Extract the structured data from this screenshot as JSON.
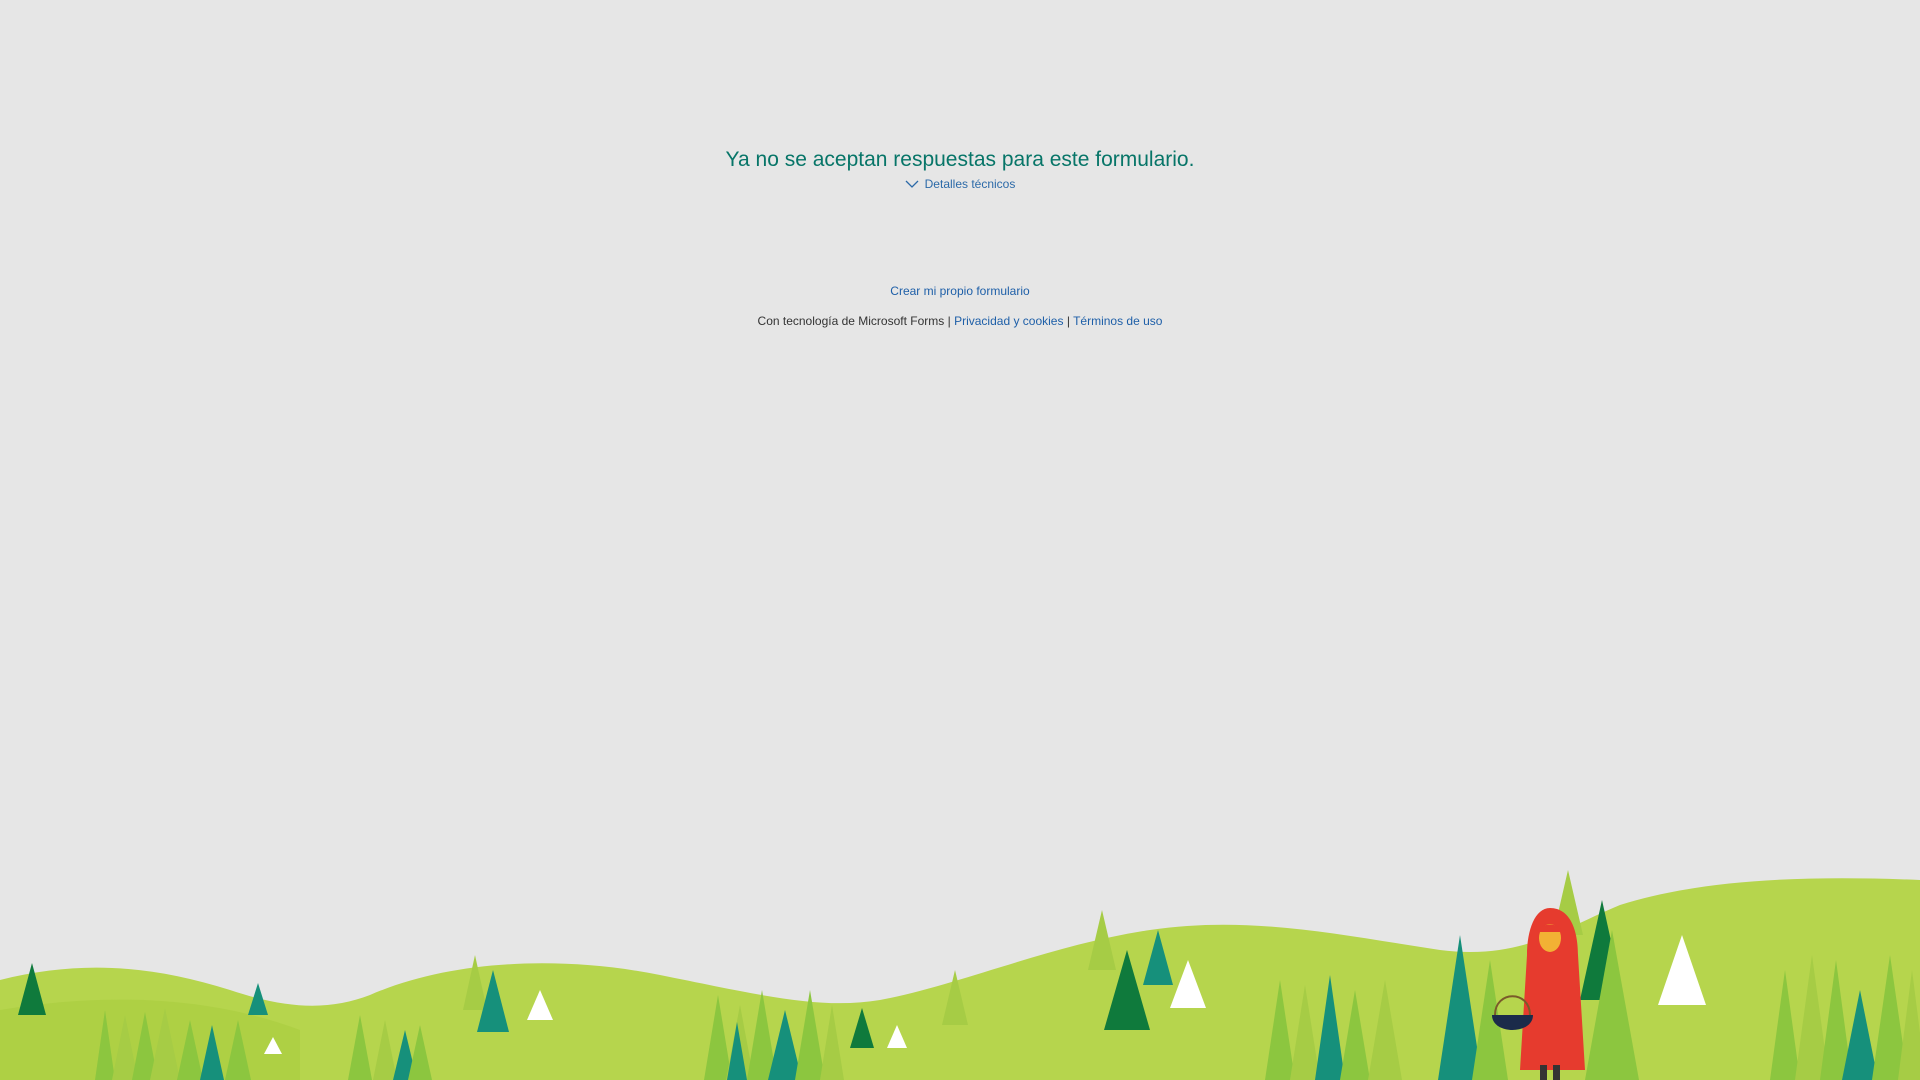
{
  "message": {
    "headline": "Ya no se aceptan respuestas para este formulario.",
    "details_label": "Detalles técnicos"
  },
  "links": {
    "create_own": "Crear mi propio formulario",
    "powered_by": "Con tecnología de Microsoft Forms",
    "separator": "|",
    "privacy": "Privacidad y cookies",
    "terms": "Términos de uso"
  },
  "colors": {
    "background": "#e6e6e6",
    "headline": "#077568",
    "link": "#1e5fa8",
    "hill_light": "#b6d54d",
    "tree_dark_green": "#0f7a3c",
    "tree_teal": "#16907b",
    "tree_lime": "#8cc63f",
    "character_red": "#e63b2e"
  },
  "illustration": {
    "icon": "forest-landscape-illustration"
  }
}
